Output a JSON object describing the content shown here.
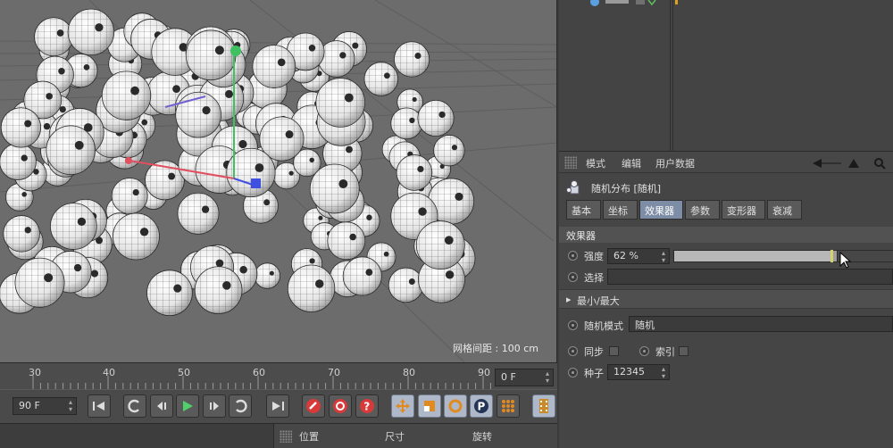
{
  "viewport": {
    "grid_spacing_label": "网格间距 : 100 cm"
  },
  "timeline": {
    "ruler_labels": [
      "30",
      "40",
      "50",
      "60",
      "70",
      "80",
      "90"
    ],
    "current_frame": "0 F",
    "end_frame": "90 F"
  },
  "coord_panel": {
    "headers": [
      "位置",
      "尺寸",
      "旋转"
    ]
  },
  "attr_manager": {
    "menu": [
      "模式",
      "编辑",
      "用户数据"
    ],
    "object_title": "随机分布 [随机]",
    "tabs": [
      "基本",
      "坐标",
      "效果器",
      "参数",
      "变形器",
      "衰减"
    ],
    "active_tab": "效果器",
    "section_title": "效果器",
    "strength_label": "强度",
    "strength_value": "62 %",
    "strength_fraction": 0.97,
    "select_label": "选择",
    "minmax_label": "最小/最大",
    "random_mode_label": "随机模式",
    "random_mode_value": "随机",
    "sync_label": "同步",
    "index_label": "索引",
    "seed_label": "种子",
    "seed_value": "12345"
  },
  "colors": {
    "viewport_bg": "#6c6c6c",
    "active_tab": "#7d8da5",
    "axis_x": "#e05060",
    "axis_y": "#40c060",
    "axis_z": "#4050e0"
  }
}
